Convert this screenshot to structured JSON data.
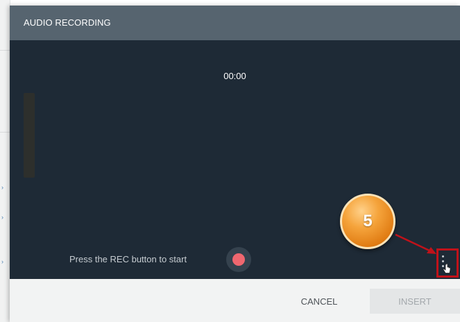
{
  "dialog": {
    "title": "AUDIO RECORDING",
    "timer": "00:00",
    "hint": "Press the REC button to start",
    "record_icon": "record-dot-icon",
    "more_icon": "vertical-dots-icon",
    "accent_color": "#f0676f"
  },
  "footer": {
    "cancel_label": "CANCEL",
    "insert_label": "INSERT"
  },
  "callout": {
    "step_number": "5",
    "color": "#e07b12",
    "highlight_color": "#c0121a"
  }
}
